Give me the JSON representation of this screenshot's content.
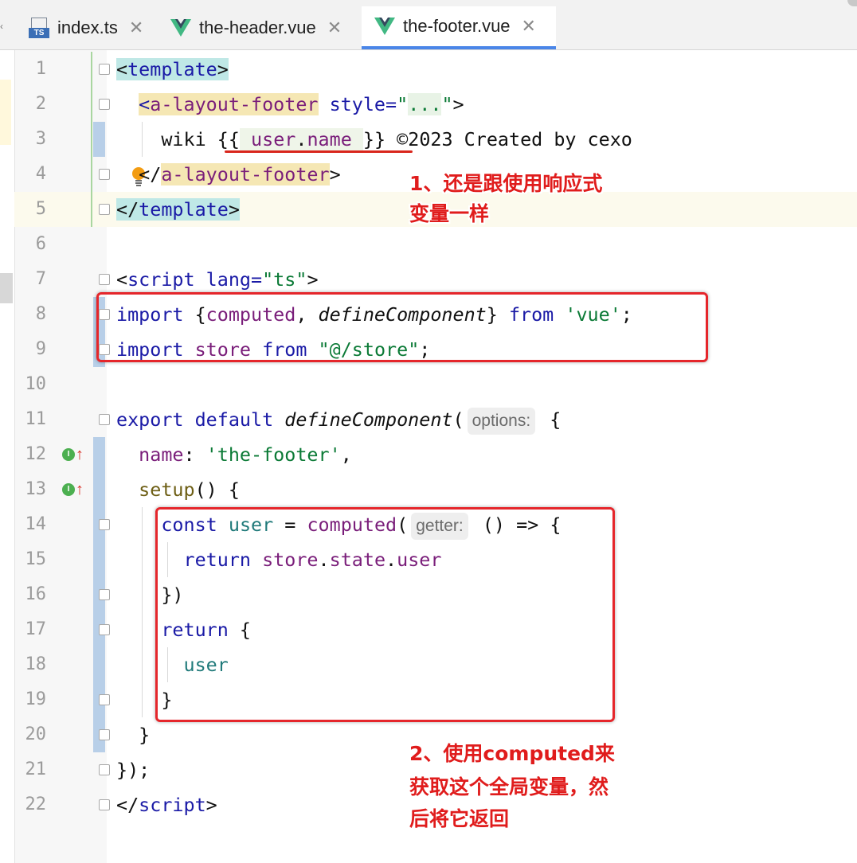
{
  "tabs": [
    {
      "label": "index.ts",
      "icon": "typescript-file-icon",
      "icon_text": "TS",
      "active": false
    },
    {
      "label": "the-header.vue",
      "icon": "vue-file-icon",
      "active": false
    },
    {
      "label": "the-footer.vue",
      "icon": "vue-file-icon",
      "active": true
    }
  ],
  "line_numbers": [
    "1",
    "2",
    "3",
    "4",
    "5",
    "6",
    "7",
    "8",
    "9",
    "10",
    "11",
    "12",
    "13",
    "14",
    "15",
    "16",
    "17",
    "18",
    "19",
    "20",
    "21",
    "22"
  ],
  "code": {
    "l1": {
      "open": "<",
      "name": "template",
      "close": ">"
    },
    "l2": {
      "open": "<",
      "name": "a-layout-footer",
      "attr": " style=",
      "q1": "\"",
      "val": "...",
      "q2": "\"",
      "close": ">"
    },
    "l3": {
      "pre": "wiki ",
      "b1": "{{",
      "sp": " ",
      "obj": "user",
      "dot": ".",
      "prop": "name",
      "sp2": " ",
      "b2": "}}",
      "post": " ©2023 Created by cexo"
    },
    "l4": {
      "open": "</",
      "name": "a-layout-footer",
      "close": ">"
    },
    "l5": {
      "open": "</",
      "name": "template",
      "close": ">"
    },
    "l7": {
      "open": "<",
      "name": "script",
      "attr": " lang=",
      "val": "\"ts\"",
      "close": ">"
    },
    "l8": {
      "kw": "import",
      "b1": " {",
      "a": "computed",
      "comma": ", ",
      "b": "defineComponent",
      "b2": "} ",
      "from": "from",
      "sp": " ",
      "str": "'vue'",
      "semi": ";"
    },
    "l9": {
      "kw": "import",
      "sp": " ",
      "name": "store",
      "sp2": " ",
      "from": "from",
      "sp3": " ",
      "str": "\"@/store\"",
      "semi": ";"
    },
    "l11": {
      "kw": "export",
      "sp": " ",
      "kw2": "default",
      "sp2": " ",
      "fn": "defineComponent",
      "paren": "(",
      "hint": "options:",
      "rest": " {"
    },
    "l12": {
      "key": "name",
      "colon": ": ",
      "str": "'the-footer'",
      "comma": ","
    },
    "l13": {
      "fn": "setup",
      "rest": "() {"
    },
    "l14": {
      "kw": "const",
      "sp": " ",
      "var": "user",
      "eq": " = ",
      "fn": "computed",
      "paren": "(",
      "hint": "getter:",
      "rest": " () => {"
    },
    "l15": {
      "kw": "return",
      "sp": " ",
      "a": "store",
      "d1": ".",
      "b": "state",
      "d2": ".",
      "c": "user"
    },
    "l16": {
      "text": "})"
    },
    "l17": {
      "kw": "return",
      "rest": " {"
    },
    "l18": {
      "var": "user"
    },
    "l19": {
      "text": "}"
    },
    "l20": {
      "text": "}"
    },
    "l21": {
      "text": "});"
    },
    "l22": {
      "open": "</",
      "name": "script",
      "close": ">"
    }
  },
  "annotations": {
    "note1_line1": "1、还是跟使用响应式",
    "note1_line2": "变量一样",
    "note2_line1": "2、使用computed来",
    "note2_line2": "获取这个全局变量，然",
    "note2_line3": "后将它返回"
  },
  "gutter_markers": {
    "implement_badge": "I"
  },
  "colors": {
    "annotation_red": "#e01c1c",
    "tab_underline": "#4a86e8",
    "keyword": "#1a1aa6",
    "string": "#0b7a36"
  }
}
